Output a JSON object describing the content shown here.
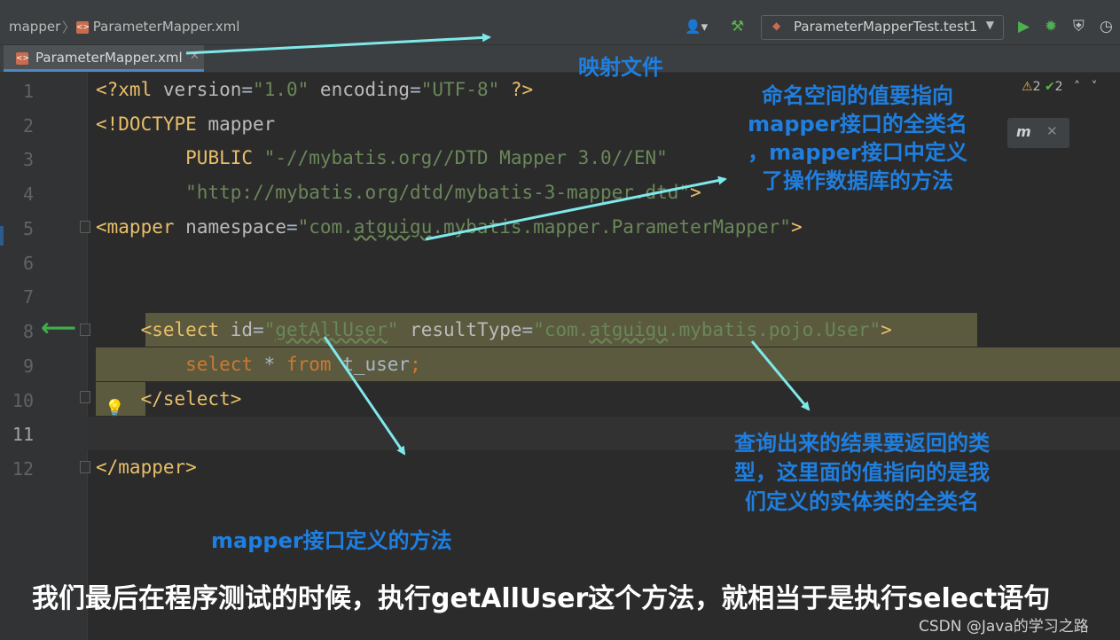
{
  "breadcrumb": {
    "folder": "mapper",
    "file": "ParameterMapper.xml"
  },
  "toolbar": {
    "run_config": "ParameterMapperTest.test1"
  },
  "tab": {
    "label": "ParameterMapper.xml"
  },
  "line_numbers": [
    "1",
    "2",
    "3",
    "4",
    "5",
    "6",
    "7",
    "8",
    "9",
    "10",
    "11",
    "12"
  ],
  "code": {
    "l1": {
      "open": "<?xml",
      "attr1": "version",
      "eq1": "=",
      "val1": "\"1.0\"",
      "attr2": "encoding",
      "eq2": "=",
      "val2": "\"UTF-8\"",
      "close": "?>"
    },
    "l2": {
      "doctype": "<!DOCTYPE",
      "name": "mapper"
    },
    "l3": {
      "public": "PUBLIC",
      "val": "\"-//mybatis.org//DTD Mapper 3.0//EN\""
    },
    "l4": {
      "val": "\"http://mybatis.org/dtd/mybatis-3-mapper.dtd\"",
      "close": ">"
    },
    "l5": {
      "tag": "<mapper",
      "attr": "namespace",
      "eq": "=",
      "q1": "\"com.",
      "squig": "atguigu",
      "rest": ".mybatis.mapper.ParameterMapper\"",
      "close": ">"
    },
    "l8": {
      "tag": "<select",
      "attr1": "id",
      "eq1": "=",
      "val1a": "\"",
      "val1sq": "getAllUser",
      "val1b": "\"",
      "attr2": "resultType",
      "eq2": "=",
      "val2a": "\"com.",
      "val2sq": "atguigu",
      "val2b": ".mybatis.pojo.User\"",
      "close": ">"
    },
    "l9": {
      "kw1": "select",
      "star": "*",
      "kw2": "from",
      "table": "t_user",
      "semi": ";"
    },
    "l10": {
      "tag": "</select>"
    },
    "l12": {
      "tag": "</mapper>"
    }
  },
  "inspections": {
    "warnings": "2",
    "weak": "2"
  },
  "annotations": {
    "mapping_file": "映射文件",
    "namespace_note": [
      "命名空间的值要指向",
      "mapper接口的全类名",
      "，mapper接口中定义",
      "了操作数据库的方法"
    ],
    "method_note": "mapper接口定义的方法",
    "result_note": [
      "查询出来的结果要返回的类",
      "型，这里面的值指向的是我",
      "们定义的实体类的全类名"
    ]
  },
  "caption": "我们最后在程序测试的时候，执行getAllUser这个方法，就相当于是执行select语句",
  "watermark": "CSDN @Java的学习之路",
  "colors": {
    "annotation_blue": "#1f7fe0",
    "arrow_cyan": "#7fe8ea",
    "highlight": "#5b5a3e",
    "tag": "#e8bf6a",
    "string": "#6a8759",
    "keyword": "#cc7832"
  },
  "icons": [
    "xml-file-icon",
    "user-icon",
    "hammer-icon",
    "run-icon",
    "debug-icon",
    "coverage-icon",
    "profile-icon",
    "fold-icon",
    "bulb-icon",
    "gutter-arrow-icon",
    "warning-icon",
    "check-icon",
    "mybatis-logo-icon"
  ]
}
